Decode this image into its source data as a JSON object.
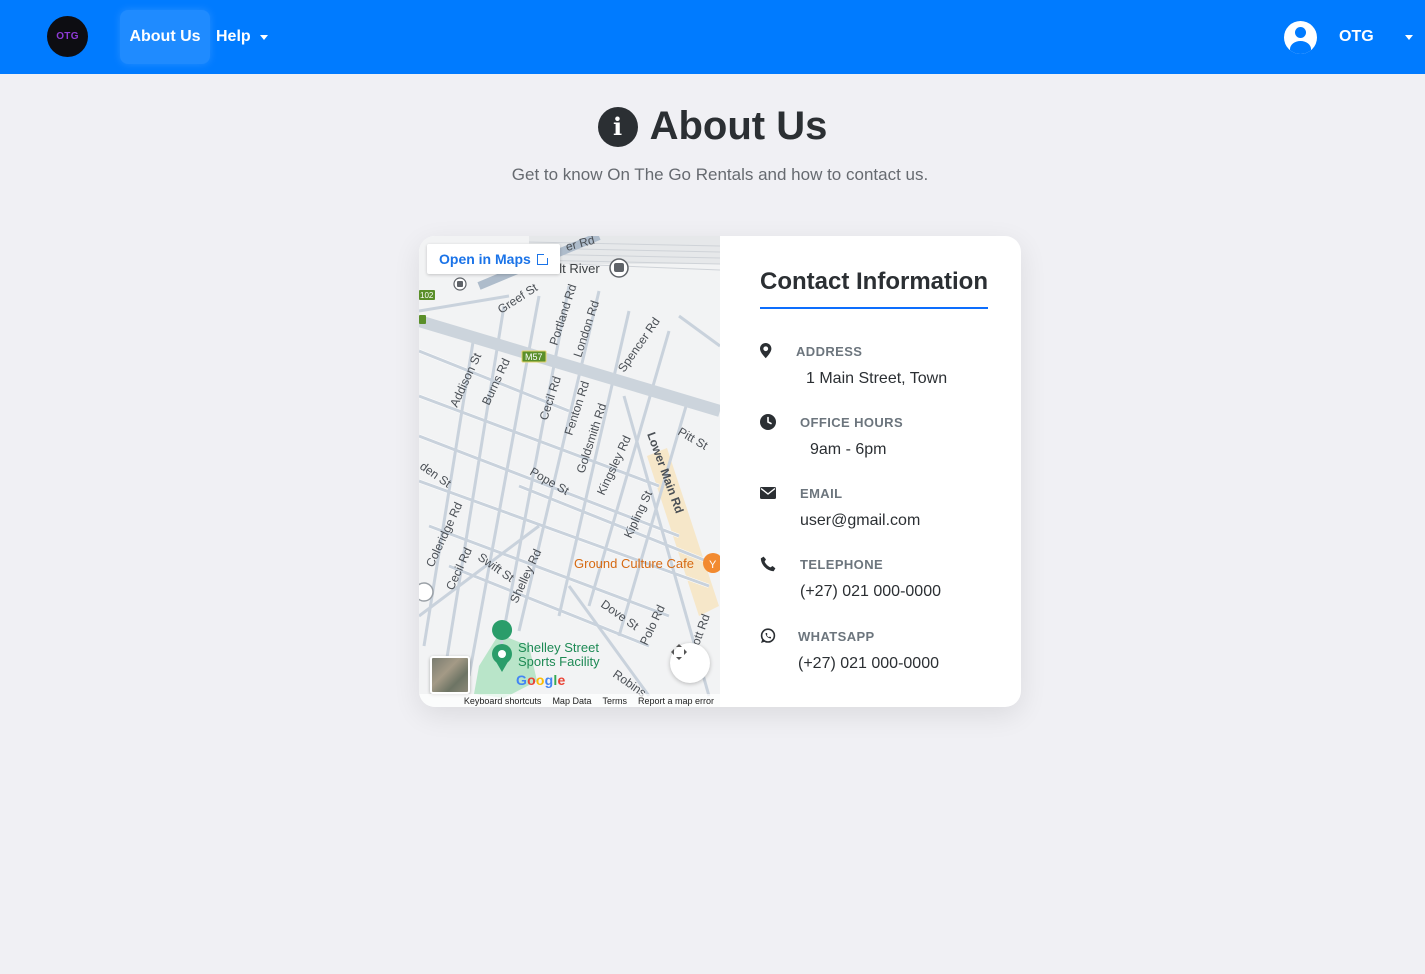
{
  "navbar": {
    "logo_text": "OTG",
    "active_item": "About Us",
    "help_label": "Help",
    "user_name": "OTG"
  },
  "header": {
    "title": "About Us",
    "subtitle": "Get to know On The Go Rentals and how to contact us."
  },
  "map": {
    "open_in_maps": "Open in Maps",
    "place_cafe": "Ground Culture Cafe",
    "place_park_line1": "Shelley Street",
    "place_park_line2": "Sports Facility",
    "station": "alt River",
    "route_badge": "M57",
    "google": "Google",
    "footer": [
      "Keyboard shortcuts",
      "Map Data",
      "Terms",
      "Report a map error"
    ],
    "streets": [
      "Greef St",
      "Portland Rd",
      "London Rd",
      "Spencer Rd",
      "Addison St",
      "Burns Rd",
      "Cecil Rd",
      "Fenton Rd",
      "Goldsmith Rd",
      "Kingsley Rd",
      "Lower Main Rd",
      "Pitt St",
      "Pope St",
      "Kipling St",
      "Coleridge Rd",
      "Cecil Rd",
      "Swift St",
      "Shelley Rd",
      "Dove St",
      "Polo Rd",
      "Robins",
      "ott Rd",
      "den St",
      "er Rd",
      "102"
    ]
  },
  "contact": {
    "title": "Contact Information",
    "address_label": "ADDRESS",
    "address_value": "1 Main Street, Town",
    "hours_label": "OFFICE HOURS",
    "hours_value": "9am - 6pm",
    "email_label": "EMAIL",
    "email_value": "user@gmail.com",
    "telephone_label": "TELEPHONE",
    "telephone_value": "(+27) 021 000-0000",
    "whatsapp_label": "WHATSAPP",
    "whatsapp_value": "(+27) 021 000-0000"
  },
  "colors": {
    "navbar": "#007bff",
    "accent_line": "#0d6efd",
    "background": "#f0f0f4"
  }
}
